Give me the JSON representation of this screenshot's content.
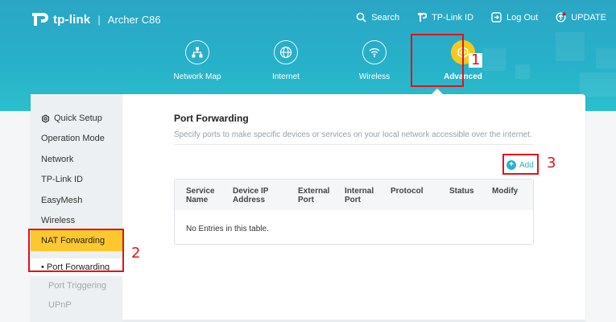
{
  "header": {
    "brand": "tp-link",
    "separator": "|",
    "model": "Archer C86",
    "top_links": [
      {
        "label": "Search",
        "icon": "search-icon"
      },
      {
        "label": "TP-Link ID",
        "icon": "tplink-id-icon"
      },
      {
        "label": "Log Out",
        "icon": "logout-icon"
      },
      {
        "label": "UPDATE",
        "icon": "update-icon"
      }
    ],
    "main_tabs": [
      {
        "label": "Network Map",
        "icon": "network-map-icon",
        "active": false
      },
      {
        "label": "Internet",
        "icon": "globe-icon",
        "active": false
      },
      {
        "label": "Wireless",
        "icon": "wifi-icon",
        "active": false
      },
      {
        "label": "Advanced",
        "icon": "gear-icon",
        "active": true
      }
    ]
  },
  "sidebar": {
    "items": [
      {
        "label": "Quick Setup",
        "icon": "gear-icon"
      },
      {
        "label": "Operation Mode"
      },
      {
        "label": "Network"
      },
      {
        "label": "TP-Link ID"
      },
      {
        "label": "EasyMesh"
      },
      {
        "label": "Wireless"
      }
    ],
    "active_section": "NAT Forwarding",
    "sub_items": [
      {
        "label": "Port Forwarding",
        "active": true
      },
      {
        "label": "Port Triggering",
        "active": false
      },
      {
        "label": "UPnP",
        "active": false
      }
    ]
  },
  "content": {
    "title": "Port Forwarding",
    "description": "Specify ports to make specific devices or services on your local network accessible over the internet.",
    "add_label": "Add",
    "table": {
      "headers": [
        [
          "Service",
          "Name"
        ],
        [
          "Device IP",
          "Address"
        ],
        [
          "External",
          "Port"
        ],
        [
          "Internal",
          "Port"
        ],
        [
          "Protocol",
          ""
        ],
        [
          "Status",
          ""
        ],
        [
          "Modify",
          ""
        ]
      ],
      "empty_text": "No Entries in this table."
    }
  },
  "annotations": [
    "1",
    "2",
    "3"
  ],
  "colors": {
    "header": "#27b0c9",
    "accent_yellow": "#fdc82e",
    "add_blue": "#2bb0d0",
    "annotation_red": "#e2131b"
  }
}
